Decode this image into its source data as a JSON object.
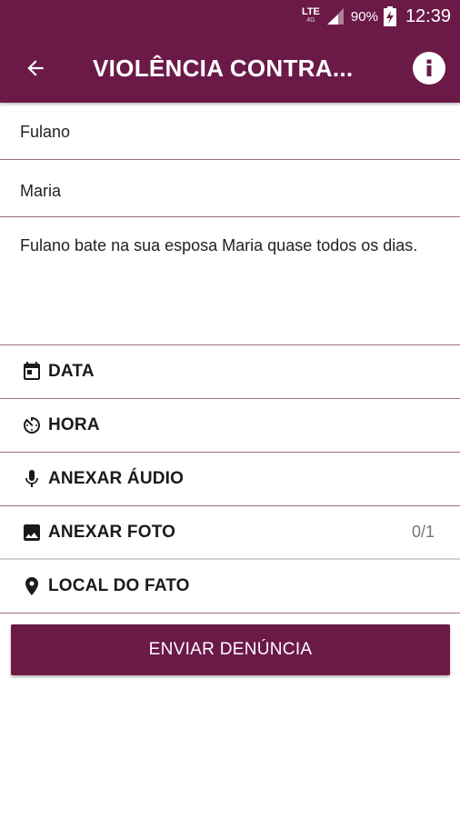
{
  "status_bar": {
    "network": "LTE",
    "network_sub": "4G",
    "battery": "90%",
    "time": "12:39"
  },
  "toolbar": {
    "title": "VIOLÊNCIA CONTRA..."
  },
  "form": {
    "aggressor": "Fulano",
    "victim": "Maria",
    "description": "Fulano bate na sua esposa Maria quase todos os dias."
  },
  "options": {
    "date_label": "DATA",
    "time_label": "HORA",
    "audio_label": "ANEXAR ÁUDIO",
    "photo_label": "ANEXAR FOTO",
    "photo_count": "0/1",
    "location_label": "LOCAL DO FATO"
  },
  "submit_label": "ENVIAR DENÚNCIA",
  "colors": {
    "primary": "#6b1a48",
    "divider": "#a06a86"
  }
}
